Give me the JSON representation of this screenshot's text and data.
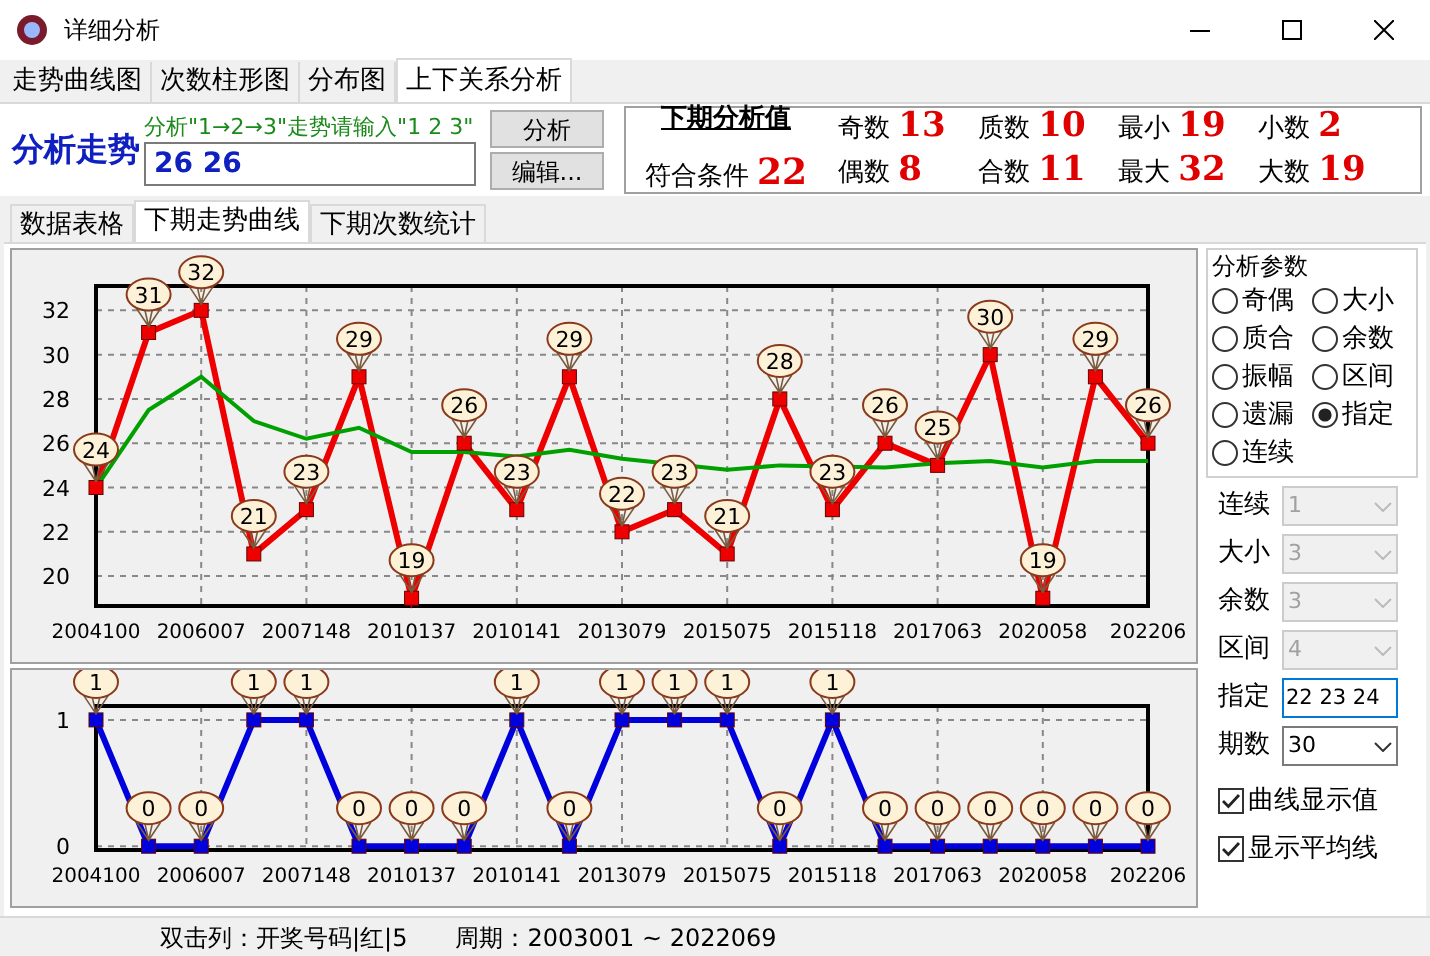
{
  "window": {
    "title": "详细分析"
  },
  "tabs": [
    {
      "label": "走势曲线图",
      "selected": false
    },
    {
      "label": "次数柱形图",
      "selected": false
    },
    {
      "label": "分布图",
      "selected": false
    },
    {
      "label": "上下关系分析",
      "selected": true
    }
  ],
  "analysis": {
    "label": "分析走势",
    "hint": "分析\"1→2→3\"走势请输入\"1 2 3\"",
    "value": "26 26",
    "buttons": [
      "分析",
      "编辑..."
    ]
  },
  "next_values": {
    "title": "下期分析值",
    "condition_label": "符合条件",
    "condition_value": "22",
    "stats": [
      {
        "label": "奇数",
        "value": "13"
      },
      {
        "label": "偶数",
        "value": "8"
      },
      {
        "label": "质数",
        "value": "10"
      },
      {
        "label": "合数",
        "value": "11"
      },
      {
        "label": "最小",
        "value": "19"
      },
      {
        "label": "最大",
        "value": "32"
      },
      {
        "label": "小数",
        "value": "2"
      },
      {
        "label": "大数",
        "value": "19"
      }
    ]
  },
  "sub_tabs": [
    {
      "label": "数据表格",
      "selected": false
    },
    {
      "label": "下期走势曲线",
      "selected": true
    },
    {
      "label": "下期次数统计",
      "selected": false
    }
  ],
  "charts": [
    {
      "chart_data": {
        "type": "line",
        "categories": [
          "2004100",
          null,
          "2006007",
          null,
          "2007148",
          null,
          "2010137",
          null,
          "2010141",
          null,
          "2013079",
          null,
          "2015075",
          null,
          "2015118",
          null,
          "2017063",
          null,
          "2020058",
          null,
          "202206"
        ],
        "ylim": [
          18.65,
          33.1
        ],
        "yticks": [
          20,
          22,
          24,
          26,
          28,
          30,
          32
        ],
        "grid": true,
        "series": [
          {
            "color": "#ee0000",
            "marker": "s",
            "values": [
              24,
              31,
              32,
              21,
              23,
              29,
              19,
              26,
              23,
              29,
              22,
              23,
              21,
              28,
              23,
              26,
              25,
              30,
              19,
              29,
              26
            ],
            "value_labels": [
              "24",
              "31",
              "32",
              "21",
              "23",
              "29",
              "19",
              "26",
              "23",
              "29",
              "22",
              "23",
              "21",
              "28",
              "23",
              "26",
              "25",
              "30",
              "19",
              "29",
              "26"
            ]
          },
          {
            "color": "#00a000",
            "values": [
              24,
              27.5,
              29,
              27,
              26.2,
              26.7,
              25.6,
              25.6,
              25.4,
              25.7,
              25.3,
              null,
              24.8,
              25,
              null,
              24.9,
              25.1,
              25.2,
              24.9,
              25.2,
              25.2
            ]
          }
        ]
      }
    },
    {
      "chart_data": {
        "type": "line",
        "categories": [
          "2004100",
          null,
          "2006007",
          null,
          "2007148",
          null,
          "2010137",
          null,
          "2010141",
          null,
          "2013079",
          null,
          "2015075",
          null,
          "2015118",
          null,
          "2017063",
          null,
          "2020058",
          null,
          "202206"
        ],
        "ylim": [
          -0.03,
          1.11
        ],
        "yticks": [
          0,
          1
        ],
        "grid": true,
        "series": [
          {
            "color": "#0000dd",
            "marker": "s",
            "values": [
              1,
              0,
              0,
              1,
              1,
              0,
              0,
              0,
              1,
              0,
              1,
              1,
              1,
              0,
              1,
              0,
              0,
              0,
              0,
              0,
              0
            ],
            "value_labels": [
              "1",
              "0",
              "0",
              "1",
              "1",
              "0",
              "0",
              "0",
              "1",
              "0",
              "1",
              "1",
              "1",
              "0",
              "1",
              "0",
              "0",
              "0",
              "0",
              "0",
              "0"
            ]
          }
        ]
      }
    }
  ],
  "params": {
    "title": "分析参数",
    "options": [
      {
        "label": "奇偶",
        "selected": false
      },
      {
        "label": "大小",
        "selected": false
      },
      {
        "label": "质合",
        "selected": false
      },
      {
        "label": "余数",
        "selected": false
      },
      {
        "label": "振幅",
        "selected": false
      },
      {
        "label": "区间",
        "selected": false
      },
      {
        "label": "遗漏",
        "selected": false
      },
      {
        "label": "指定",
        "selected": true
      },
      {
        "label": "连续",
        "selected": false
      }
    ]
  },
  "settings": [
    {
      "kind": "select",
      "label": "连续",
      "value": "1",
      "disabled": true
    },
    {
      "kind": "select",
      "label": "大小",
      "value": "3",
      "disabled": true
    },
    {
      "kind": "select",
      "label": "余数",
      "value": "3",
      "disabled": true
    },
    {
      "kind": "select",
      "label": "区间",
      "value": "4",
      "disabled": true
    },
    {
      "kind": "input",
      "label": "指定",
      "value": "22 23 24",
      "disabled": false
    },
    {
      "kind": "select",
      "label": "期数",
      "value": "30",
      "disabled": false
    }
  ],
  "checkboxes": [
    {
      "label": "曲线显示值",
      "checked": true
    },
    {
      "label": "显示平均线",
      "checked": true
    }
  ],
  "status_bar": [
    "双击列：开奖号码|红|5",
    "周期：2003001 ~ 2022069"
  ]
}
